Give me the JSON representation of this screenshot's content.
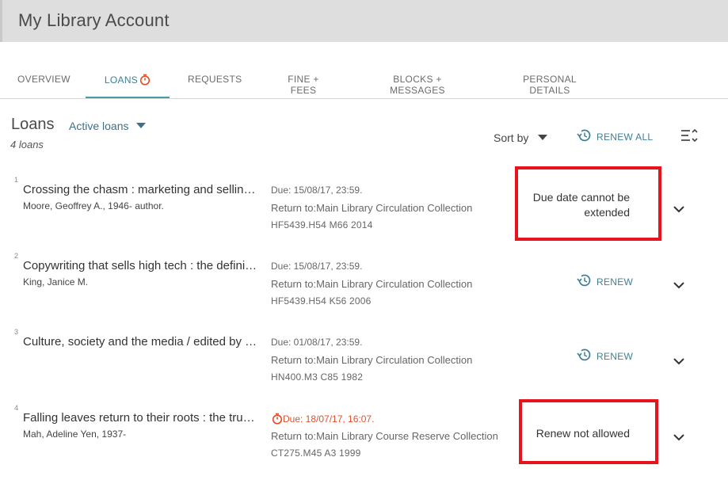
{
  "header": {
    "title": "My Library Account"
  },
  "tabs": [
    {
      "label": "OVERVIEW"
    },
    {
      "label": "LOANS"
    },
    {
      "label": "REQUESTS"
    },
    {
      "label": "FINE + FEES"
    },
    {
      "label": "BLOCKS + MESSAGES"
    },
    {
      "label": "PERSONAL DETAILS"
    }
  ],
  "loans": {
    "title": "Loans",
    "filter_label": "Active loans",
    "count_label": "4 loans",
    "sort_label": "Sort by",
    "renew_all_label": "RENEW ALL"
  },
  "items": [
    {
      "index": "1",
      "title": "Crossing the chasm : marketing and selling disruptive products to mainstream customers",
      "author": "Moore, Geoffrey A., 1946- author.",
      "due": "Due: 15/08/17, 23:59.",
      "return_to": "Return to:Main Library Circulation Collection",
      "call_number": "HF5439.H54 M66 2014",
      "status": "Due date cannot be extended"
    },
    {
      "index": "2",
      "title": "Copywriting that sells high tech : the definitive guide",
      "author": "King, Janice M.",
      "due": "Due: 15/08/17, 23:59.",
      "return_to": "Return to:Main Library Circulation Collection",
      "call_number": "HF5439.H54 K56 2006",
      "action": "RENEW"
    },
    {
      "index": "3",
      "title": "Culture, society and the media / edited by Michael Gurevitch",
      "author": "",
      "due": "Due: 01/08/17, 23:59.",
      "return_to": "Return to:Main Library Circulation Collection",
      "call_number": "HN400.M3 C85 1982",
      "action": "RENEW"
    },
    {
      "index": "4",
      "title": "Falling leaves return to their roots : the true story of an unwanted Chinese daughter",
      "author": "Mah, Adeline Yen, 1937-",
      "due": "Due: 18/07/17, 16:07.",
      "return_to": "Return to:Main Library Course Reserve Collection",
      "call_number": "CT275.M45 A3 1999",
      "status": "Renew not allowed"
    }
  ],
  "colors": {
    "accent": "#3f7f96",
    "overdue": "#e0502b",
    "highlight_box": "#e8141b",
    "header_bg": "#dedede"
  }
}
